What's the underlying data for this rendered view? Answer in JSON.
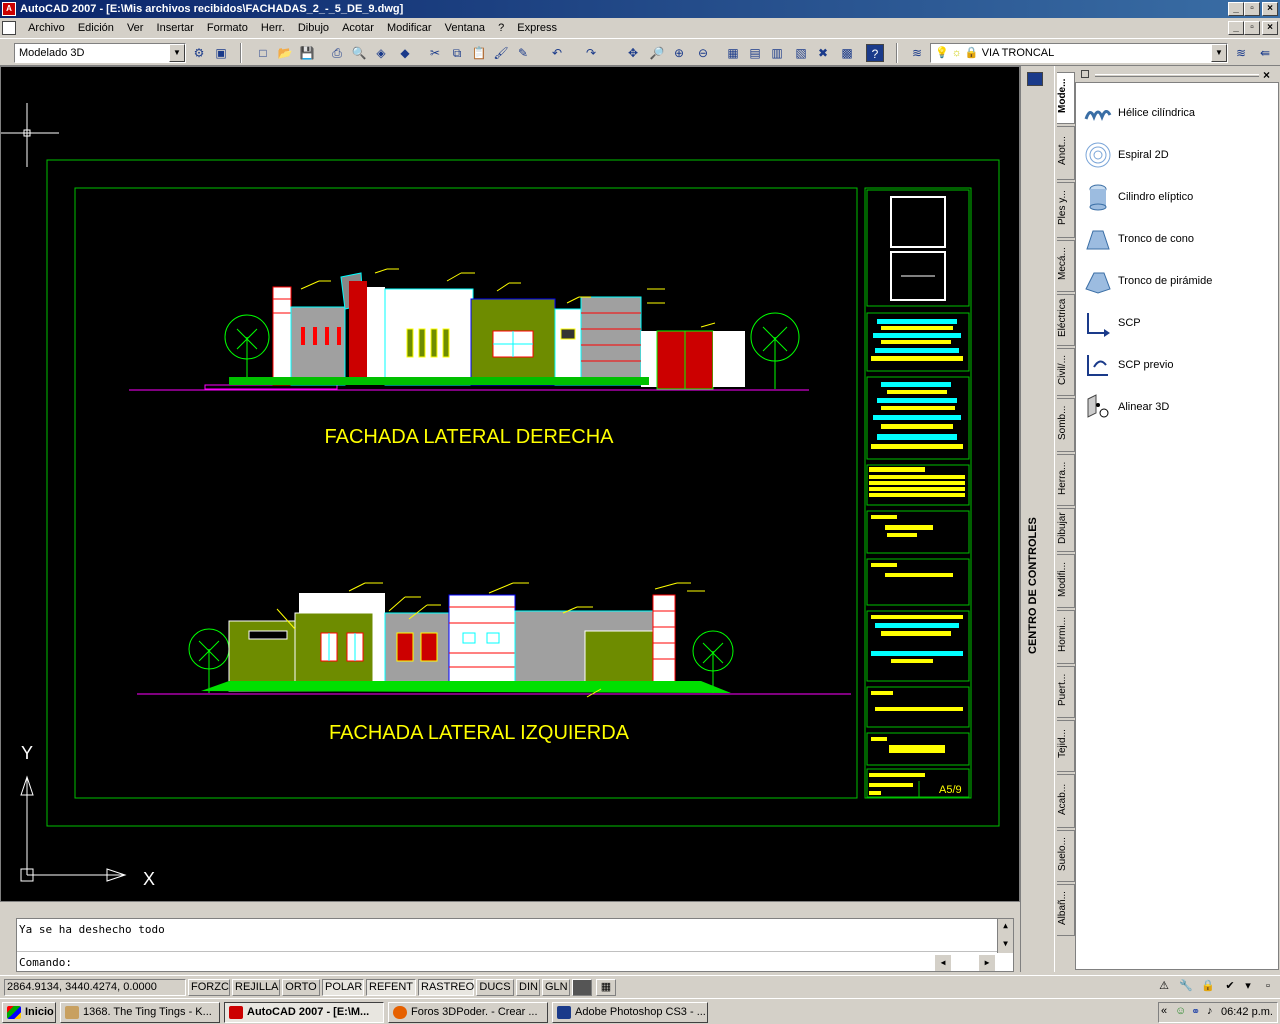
{
  "window": {
    "title": "AutoCAD 2007 - [E:\\Mis archivos recibidos\\FACHADAS_2_-_5_DE_9.dwg]",
    "app_icon": "A"
  },
  "menu": [
    "Archivo",
    "Edición",
    "Ver",
    "Insertar",
    "Formato",
    "Herr.",
    "Dibujo",
    "Acotar",
    "Modificar",
    "Ventana",
    "?",
    "Express"
  ],
  "toolbar": {
    "workspace": "Modelado 3D",
    "layer": "VIA TRONCAL"
  },
  "drawing": {
    "facade1_title": "FACHADA LATERAL DERECHA",
    "facade2_title": "FACHADA LATERAL IZQUIERDA",
    "sheet": "A5/9",
    "ucs_y": "Y",
    "ucs_x": "X",
    "colors": {
      "yellow": "#ffff00",
      "green": "#00ff00",
      "cyan": "#00ffff",
      "magenta": "#ff00ff",
      "olive": "#6e8c00",
      "red": "#ff0000",
      "frame": "#00c000"
    }
  },
  "command": {
    "history": "Ya se ha deshecho todo",
    "prompt": "Comando:"
  },
  "status": {
    "coords": "2864.9134, 3440.4274, 0.0000",
    "buttons": [
      "FORZC",
      "REJILLA",
      "ORTO",
      "POLAR",
      "REFENT",
      "RASTREO",
      "DUCS",
      "DIN",
      "GLN"
    ]
  },
  "design_center": {
    "label": "CENTRO DE CONTROLES"
  },
  "palette": {
    "tabs": [
      "Mode...",
      "Anot...",
      "Ples y...",
      "Mecá...",
      "Eléctrica",
      "Civil/...",
      "Somb...",
      "Herra...",
      "Dibujar",
      "Modifi...",
      "Hormi...",
      "Puert...",
      "Tejid...",
      "Acab...",
      "Suelo...",
      "Albañ..."
    ],
    "items": [
      {
        "label": "Hélice cilíndrica",
        "icon": "helix-icon"
      },
      {
        "label": "Espiral 2D",
        "icon": "spiral-icon"
      },
      {
        "label": "Cilindro elíptico",
        "icon": "cylinder-icon"
      },
      {
        "label": "Tronco de cono",
        "icon": "cone-icon"
      },
      {
        "label": "Tronco de pirámide",
        "icon": "pyramid-icon"
      },
      {
        "label": "SCP",
        "icon": "ucs-icon"
      },
      {
        "label": "SCP previo",
        "icon": "ucs-previous-icon"
      },
      {
        "label": "Alinear 3D",
        "icon": "align-icon"
      }
    ]
  },
  "taskbar": {
    "start": "Inicio",
    "tasks": [
      "1368. The Ting Tings - K...",
      "AutoCAD 2007 - [E:\\M...",
      "Foros 3DPoder. - Crear ...",
      "Adobe Photoshop CS3 - ..."
    ],
    "clock": "06:42 p.m."
  }
}
